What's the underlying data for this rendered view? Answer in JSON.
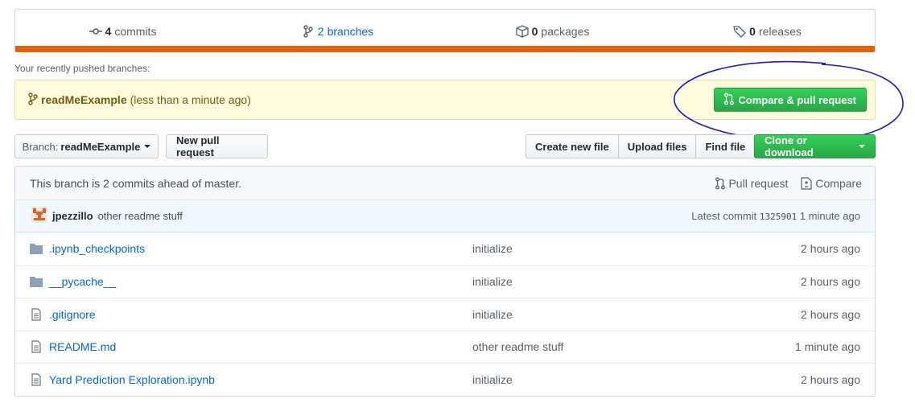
{
  "summary": {
    "commits_count": "4",
    "commits_label": "commits",
    "branches_count": "2",
    "branches_label": "branches",
    "packages_count": "0",
    "packages_label": "packages",
    "releases_count": "0",
    "releases_label": "releases"
  },
  "recent": {
    "label": "Your recently pushed branches:",
    "branch": "readMeExample",
    "time": "(less than a minute ago)",
    "compare_button": "Compare & pull request"
  },
  "toolbar": {
    "branch_prefix": "Branch:",
    "branch_name": "readMeExample",
    "new_pr": "New pull request",
    "create_file": "Create new file",
    "upload_files": "Upload files",
    "find_file": "Find file",
    "clone": "Clone or download"
  },
  "status": {
    "ahead_text": "This branch is 2 commits ahead of master.",
    "pull_request": "Pull request",
    "compare": "Compare"
  },
  "commit": {
    "author": "jpezzillo",
    "message": "other readme stuff",
    "latest_label": "Latest commit",
    "sha": "1325901",
    "age": "1 minute ago"
  },
  "files": [
    {
      "name": ".ipynb_checkpoints",
      "type": "folder",
      "message": "initialize",
      "age": "2 hours ago"
    },
    {
      "name": "__pycache__",
      "type": "folder",
      "message": "initialize",
      "age": "2 hours ago"
    },
    {
      "name": ".gitignore",
      "type": "file",
      "message": "initialize",
      "age": "2 hours ago"
    },
    {
      "name": "README.md",
      "type": "file",
      "message": "other readme stuff",
      "age": "1 minute ago"
    },
    {
      "name": "Yard Prediction Exploration.ipynb",
      "type": "file",
      "message": "initialize",
      "age": "2 hours ago"
    }
  ],
  "colors": {
    "language_bar": "#e36209",
    "link": "#0366d6",
    "green_button": "#28a745",
    "annotation_circle": "#1a1acc"
  },
  "icons": {
    "commits": "commit-icon",
    "branches": "branch-icon",
    "packages": "package-icon",
    "releases": "tag-icon",
    "folder": "folder-icon",
    "file": "file-icon"
  }
}
